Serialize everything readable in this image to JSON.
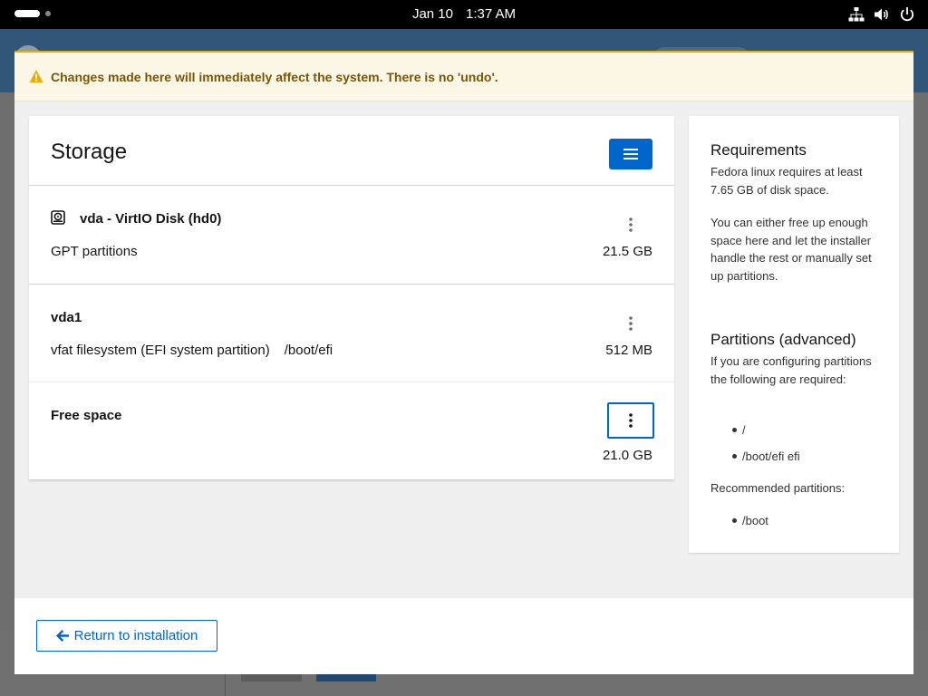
{
  "topbar": {
    "date": "Jan 10",
    "time": "1:37 AM",
    "icons": [
      "network-icon",
      "volume-icon",
      "power-icon"
    ]
  },
  "alert": {
    "text": "Changes made here will immediately affect the system. There is no 'undo'.",
    "color": "#f0ab00"
  },
  "storage": {
    "title": "Storage",
    "accent": "#0066cc",
    "disk": {
      "title": "vda - VirtIO Disk (hd0)",
      "description": "GPT partitions",
      "size": "21.5 GB"
    },
    "partitions": [
      {
        "name": "vda1",
        "description": "vfat filesystem (EFI system partition)",
        "mount": "/boot/efi",
        "size": "512 MB"
      }
    ],
    "free_space": {
      "label": "Free space",
      "size": "21.0 GB"
    }
  },
  "requirements": {
    "title": "Requirements",
    "text1": "Fedora linux requires at least 7.65 GB of disk space.",
    "text2": "You can either free up enough space here and let the installer handle the rest or manually set up partitions.",
    "advanced_title": "Partitions (advanced)",
    "advanced_text": "If you are configuring partitions the following are required:",
    "required": [
      "/",
      "/boot/efi efi"
    ],
    "recommended_label": "Recommended partitions:",
    "recommended": [
      "/boot"
    ]
  },
  "footer": {
    "return_label": "Return to installation"
  }
}
